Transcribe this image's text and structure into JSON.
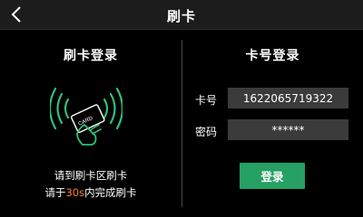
{
  "header": {
    "title": "刷卡",
    "back_icon": "chevron-left-icon"
  },
  "card_login": {
    "heading": "刷卡登录",
    "illustration_icon": "card-tap-icon",
    "illustration_color": "#2fbf7a",
    "card_text": "CARD",
    "hint_line1": "请到刷卡区刷卡",
    "hint_line2_prefix": "请于",
    "hint_line2_time": "30s",
    "hint_line2_suffix": "内完成刷卡",
    "accent_color": "#f5812c"
  },
  "number_login": {
    "heading": "卡号登录",
    "card_label": "卡号",
    "card_value": "1622065719322",
    "password_label": "密码",
    "password_value": "******",
    "login_button": "登录",
    "button_color": "#26a063"
  }
}
